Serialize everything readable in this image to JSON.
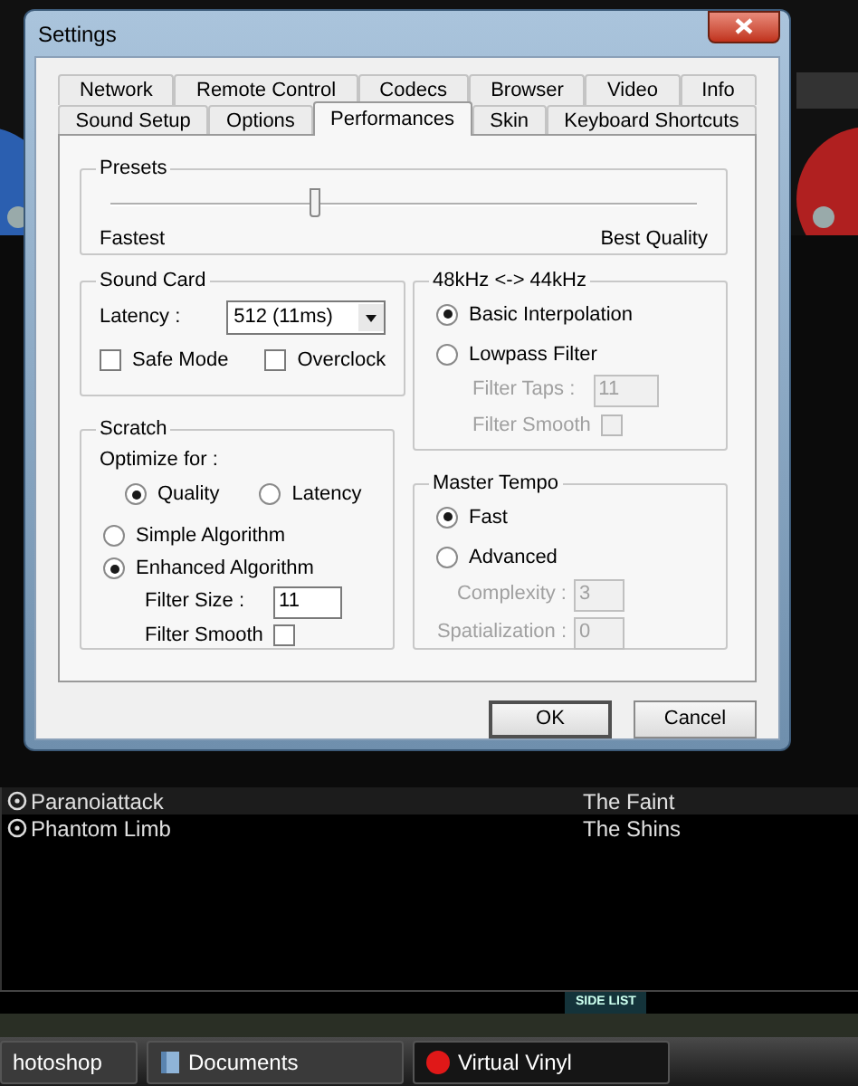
{
  "dialog": {
    "title": "Settings"
  },
  "tabs": [
    [
      {
        "label": "Network",
        "selected": false
      },
      {
        "label": "Remote Control",
        "selected": false
      },
      {
        "label": "Codecs",
        "selected": false
      },
      {
        "label": "Browser",
        "selected": false
      },
      {
        "label": "Video",
        "selected": false
      },
      {
        "label": "Info",
        "selected": false
      }
    ],
    [
      {
        "label": "Sound Setup",
        "selected": false
      },
      {
        "label": "Options",
        "selected": false
      },
      {
        "label": "Performances",
        "selected": true
      },
      {
        "label": "Skin",
        "selected": false
      },
      {
        "label": "Keyboard Shortcuts",
        "selected": false
      }
    ]
  ],
  "presets": {
    "title": "Presets",
    "level": 0.35,
    "min_label": "Fastest",
    "max_label": "Best Quality"
  },
  "sound_card": {
    "title": "Sound Card",
    "latency_label": "Latency :",
    "latency_value": "512 (11ms)",
    "checkboxes": [
      {
        "label": "Safe Mode",
        "checked": false
      },
      {
        "label": "Overclock",
        "checked": false
      }
    ]
  },
  "scratch": {
    "title": "Scratch",
    "optimize_label": "Optimize for :",
    "optimize": [
      {
        "label": "Quality",
        "selected": true
      },
      {
        "label": "Latency",
        "selected": false
      }
    ],
    "algorithms": [
      {
        "label": "Simple Algorithm",
        "selected": false
      },
      {
        "label": "Enhanced Algorithm",
        "selected": true
      }
    ],
    "filter_size_label": "Filter Size :",
    "filter_size": "11",
    "filter_smooth": {
      "label": "Filter Smooth",
      "checked": false
    }
  },
  "resampling": {
    "title": "48kHz <-> 44kHz",
    "modes": [
      {
        "label": "Basic Interpolation",
        "selected": true
      },
      {
        "label": "Lowpass Filter",
        "selected": false
      }
    ],
    "filter_taps_label": "Filter Taps :",
    "filter_taps": "11",
    "disabled": true,
    "filter_smooth": {
      "label": "Filter Smooth",
      "checked": false,
      "disabled": true
    }
  },
  "master_tempo": {
    "title": "Master Tempo",
    "modes": [
      {
        "label": "Fast",
        "selected": true
      },
      {
        "label": "Advanced",
        "selected": false
      }
    ],
    "disabled": true,
    "fields": [
      {
        "label": "Complexity :",
        "value": "3"
      },
      {
        "label": "Spatialization :",
        "value": "0"
      }
    ]
  },
  "buttons": [
    {
      "label": "OK",
      "default": true
    },
    {
      "label": "Cancel",
      "default": false
    }
  ],
  "tracks": [
    {
      "title": "Paranoiattack",
      "artist": "The Faint",
      "selected": true
    },
    {
      "title": "Phantom Limb",
      "artist": "The Shins",
      "selected": false
    }
  ],
  "side_list": "SIDE LIST",
  "taskbar": [
    {
      "label": "hotoshop",
      "kind": "plain",
      "active": false
    },
    {
      "label": "Documents",
      "kind": "folder",
      "active": false
    },
    {
      "label": "Virtual Vinyl",
      "kind": "record",
      "active": true
    }
  ]
}
